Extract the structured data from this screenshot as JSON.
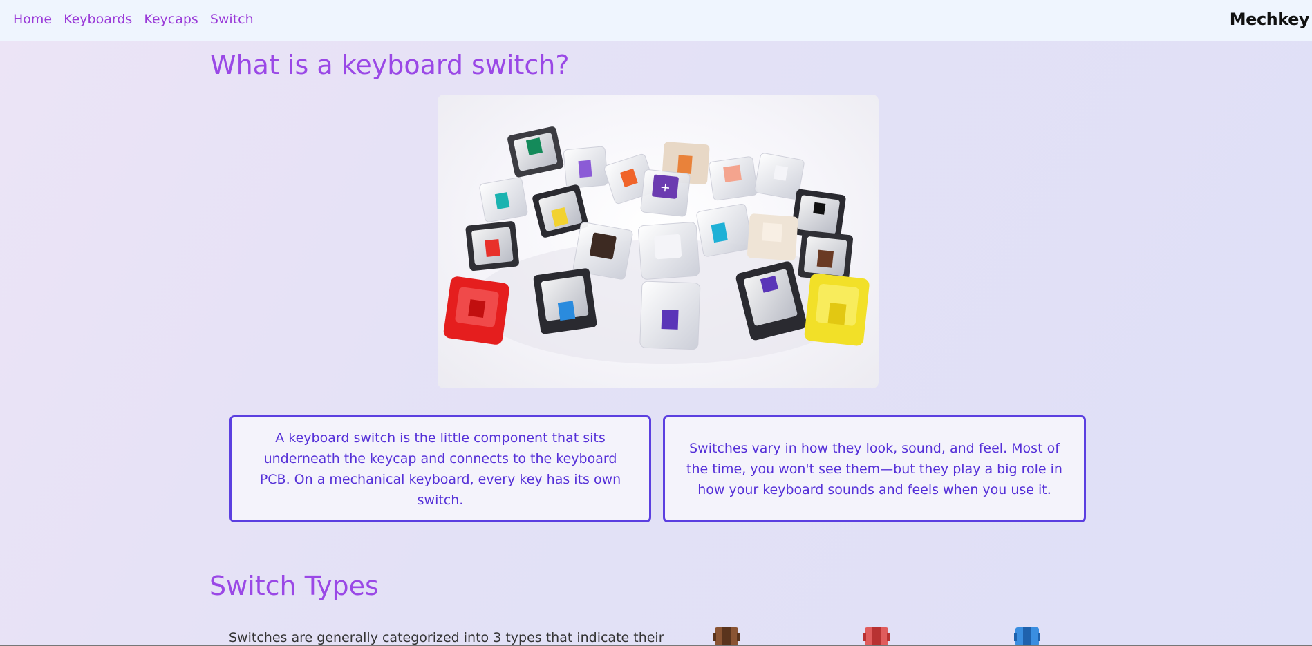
{
  "nav": {
    "links": [
      {
        "label": "Home"
      },
      {
        "label": "Keyboards"
      },
      {
        "label": "Keycaps"
      },
      {
        "label": "Switch"
      }
    ],
    "brand": "Mechkey"
  },
  "intro": {
    "title": "What is a keyboard switch?",
    "paragraphs": [
      "A keyboard switch is the little component that sits underneath the keycap and connects to the keyboard PCB. On a mechanical keyboard, every key has its own switch.",
      "Switches vary in how they look, sound, and feel. Most of the time, you won't see them—but they play a big role in how your keyboard sounds and feels when you use it."
    ]
  },
  "types": {
    "title": "Switch Types",
    "text": "Switches are generally categorized into 3 types that indicate their",
    "icons": [
      {
        "name": "brown-switch-icon",
        "color": "#8a5433"
      },
      {
        "name": "red-switch-icon",
        "color": "#e05c5c"
      },
      {
        "name": "blue-switch-icon",
        "color": "#3a8ee0"
      }
    ]
  }
}
